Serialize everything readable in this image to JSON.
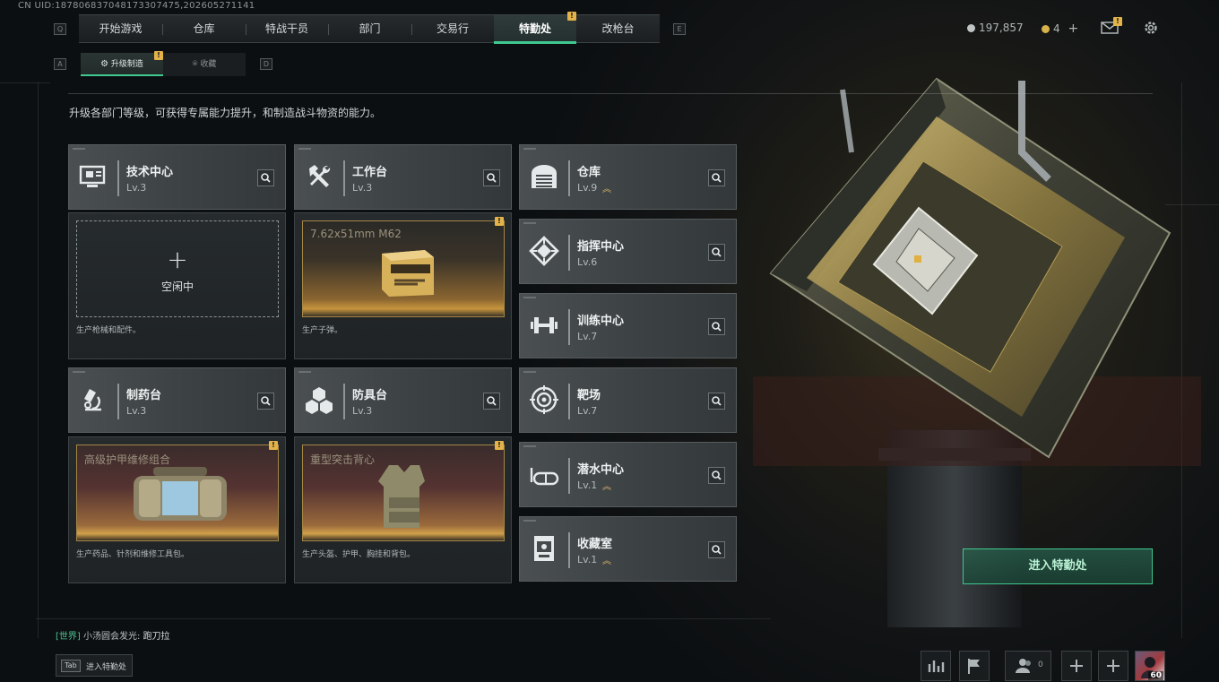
{
  "uid": "CN UID:18780683704817330747 5,202605271141",
  "uid_display": "CN UID:187806837048173307475,202605271141",
  "keys": {
    "prev_tab": "Q",
    "next_tab": "E",
    "prev_sub": "A",
    "next_sub": "D"
  },
  "nav": {
    "tabs": [
      {
        "label": "开始游戏",
        "active": false
      },
      {
        "label": "仓库",
        "active": false
      },
      {
        "label": "特战干员",
        "active": false
      },
      {
        "label": "部门",
        "active": false
      },
      {
        "label": "交易行",
        "active": false
      },
      {
        "label": "特勤处",
        "active": true,
        "badge": "!"
      },
      {
        "label": "改枪台",
        "active": false
      }
    ]
  },
  "subtabs": [
    {
      "label": "升级制造",
      "active": true,
      "badge": "!"
    },
    {
      "label": "收藏",
      "active": false
    }
  ],
  "resources": {
    "currency": "197,857",
    "tokens": "4",
    "plus": "+"
  },
  "header_icons": {
    "mail_badge": "!"
  },
  "intro": "升级各部门等级，可获得专属能力提升，和制造战斗物资的能力。",
  "stations": {
    "tech": {
      "name": "技术中心",
      "level": "Lv.3"
    },
    "workbench": {
      "name": "工作台",
      "level": "Lv.3"
    },
    "pharmacy": {
      "name": "制药台",
      "level": "Lv.3"
    },
    "armor": {
      "name": "防具台",
      "level": "Lv.3"
    },
    "storage": {
      "name": "仓库",
      "level": "Lv.9",
      "upgrade": true
    },
    "command": {
      "name": "指挥中心",
      "level": "Lv.6"
    },
    "training": {
      "name": "训练中心",
      "level": "Lv.7"
    },
    "range": {
      "name": "靶场",
      "level": "Lv.7"
    },
    "diving": {
      "name": "潜水中心",
      "level": "Lv.1",
      "upgrade": true
    },
    "collection": {
      "name": "收藏室",
      "level": "Lv.1",
      "upgrade": true
    }
  },
  "production": {
    "tech": {
      "state": "空闲中",
      "desc": "生产枪械和配件。"
    },
    "workbench": {
      "item": "7.62x51mm M62",
      "desc": "生产子弹。",
      "badge": "!"
    },
    "pharmacy": {
      "item": "高级护甲维修组合",
      "desc": "生产药品、针剂和维修工具包。",
      "badge": "!"
    },
    "armor": {
      "item": "重型突击背心",
      "desc": "生产头盔、护甲、胸挂和背包。",
      "badge": "!"
    }
  },
  "enter_button": "进入特勤处",
  "chat": {
    "channel": "[世界]",
    "user": "小汤圆会发光:",
    "message": "跑刀拉"
  },
  "tab_hint": {
    "key": "Tab",
    "label": "进入特勤处"
  },
  "bottom_bar": {
    "friends_count": "0",
    "avatar_level": "60"
  },
  "colors": {
    "accent": "#3fc890",
    "badge": "#e3b34a",
    "chat_channel": "#4cc28f",
    "upgrade": "#d8b36a"
  }
}
